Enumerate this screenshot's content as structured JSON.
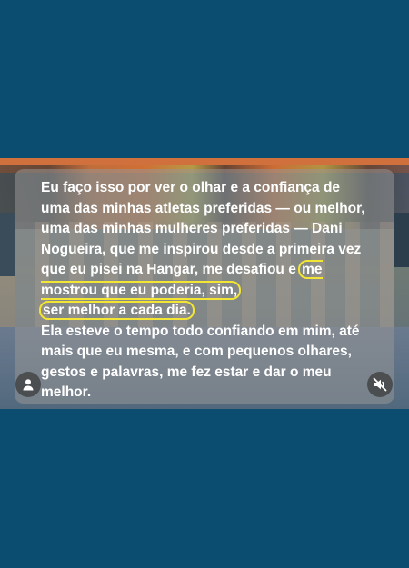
{
  "colors": {
    "page_background": "#0b4d70",
    "highlight_outline": "#f3e533",
    "caption_text": "#ffffff"
  },
  "story": {
    "paragraph1": {
      "before_highlight": "Eu faço isso por ver o olhar e a confiança de uma das minhas atletas preferidas — ou melhor, uma das minhas mulheres preferidas — Dani Nogueira, que me inspirou desde a primeira vez que eu pisei na Hangar, me desafiou e ",
      "highlight_line1": "me mostrou que eu poderia, sim,",
      "highlight_line2": "ser melhor a cada dia."
    },
    "paragraph2": "Ela esteve o tempo todo confiando em mim, até mais que eu mesma, e com pequenos olhares, gestos e palavras, me fez estar e dar o meu melhor."
  },
  "icons": {
    "avatar": "user-icon",
    "mute": "muted-speaker-icon"
  }
}
